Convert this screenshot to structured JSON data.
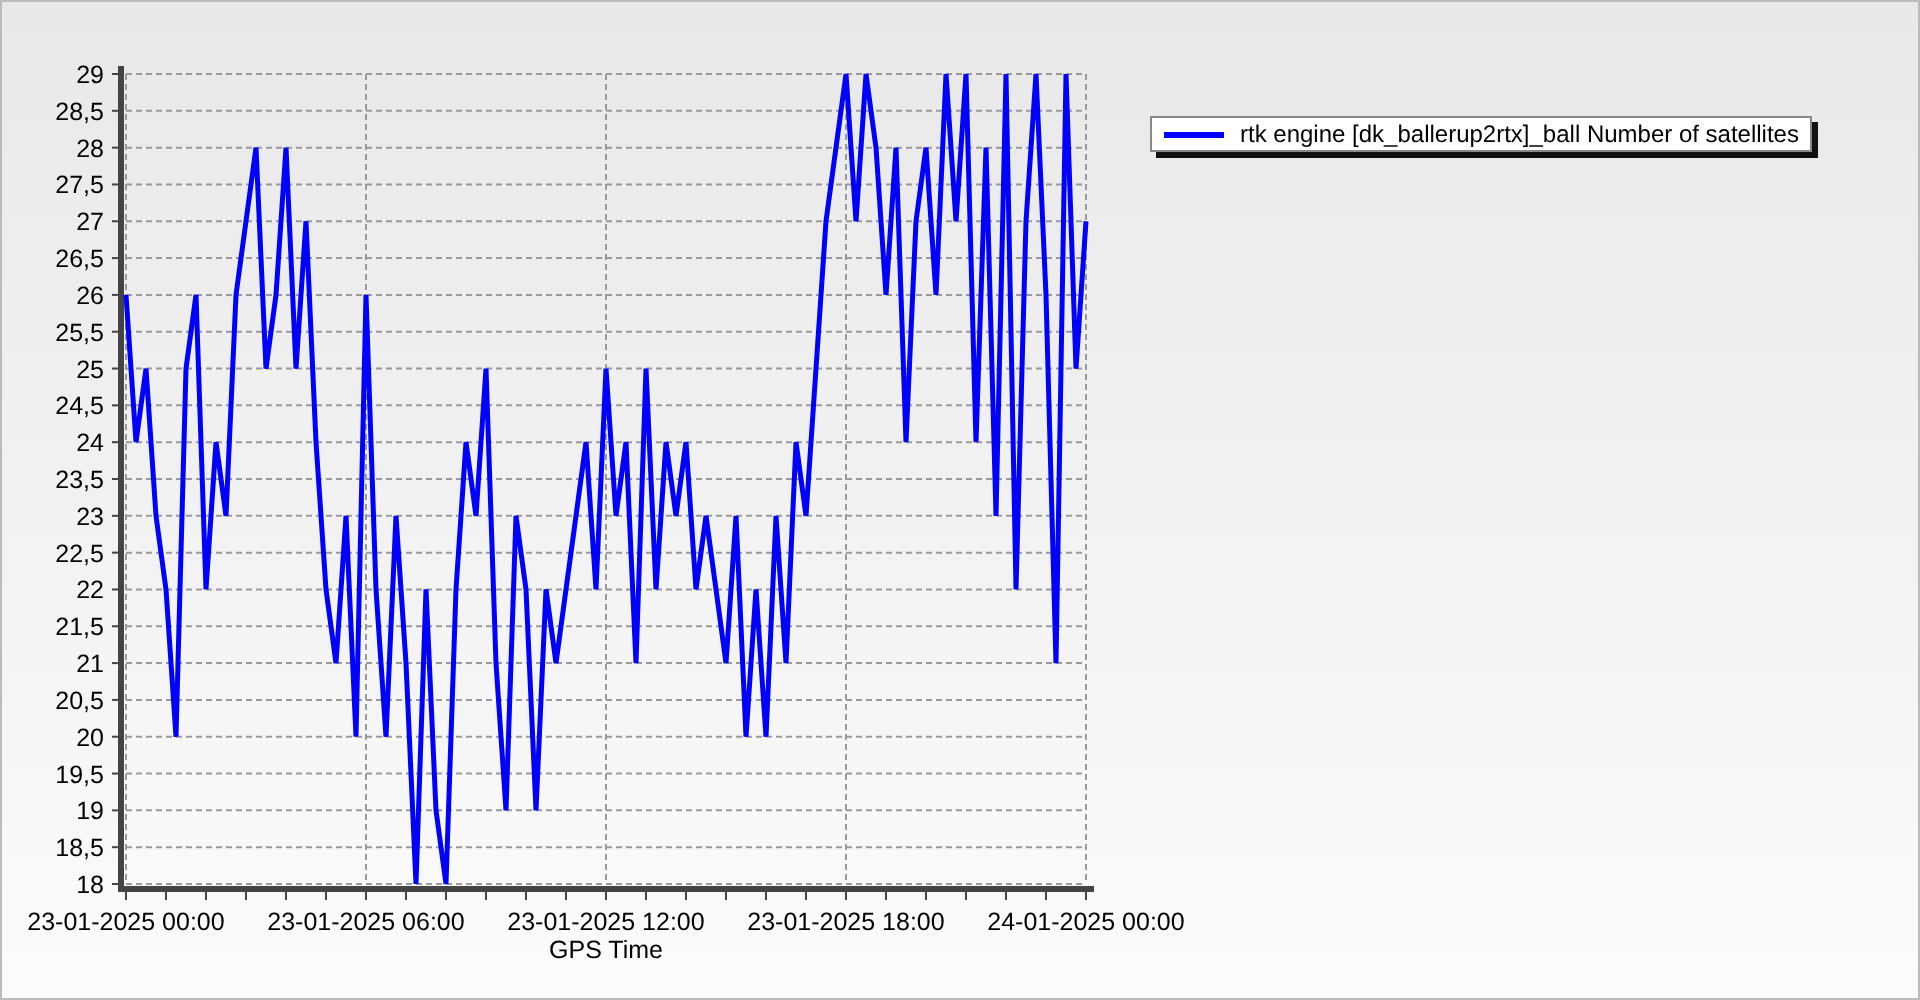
{
  "chart_data": {
    "type": "line",
    "xlabel": "GPS Time",
    "categories": [
      "23-01-2025 00:00",
      null,
      null,
      null,
      null,
      null,
      null,
      null,
      null,
      null,
      null,
      null,
      null,
      null,
      null,
      null,
      null,
      null,
      null,
      null,
      null,
      null,
      null,
      null,
      "23-01-2025 06:00",
      null,
      null,
      null,
      null,
      null,
      null,
      null,
      null,
      null,
      null,
      null,
      null,
      null,
      null,
      null,
      null,
      null,
      null,
      null,
      null,
      null,
      null,
      null,
      "23-01-2025 12:00",
      null,
      null,
      null,
      null,
      null,
      null,
      null,
      null,
      null,
      null,
      null,
      null,
      null,
      null,
      null,
      null,
      null,
      null,
      null,
      null,
      null,
      null,
      null,
      "23-01-2025 18:00",
      null,
      null,
      null,
      null,
      null,
      null,
      null,
      null,
      null,
      null,
      null,
      null,
      null,
      null,
      null,
      null,
      null,
      null,
      null,
      null,
      null,
      null,
      null,
      "24-01-2025 00:00"
    ],
    "series": [
      {
        "name": "rtk engine [dk_ballerup2rtx]_ball Number of satellites",
        "color": "#0000ff",
        "values": [
          26,
          24,
          25,
          23,
          22,
          20,
          25,
          26,
          22,
          24,
          23,
          26,
          27,
          28,
          25,
          26,
          28,
          25,
          27,
          24,
          22,
          21,
          23,
          20,
          26,
          22,
          20,
          23,
          21,
          18,
          22,
          19,
          18,
          22,
          24,
          23,
          25,
          21,
          19,
          23,
          22,
          19,
          22,
          21,
          22,
          23,
          24,
          22,
          25,
          23,
          24,
          21,
          25,
          22,
          24,
          23,
          24,
          22,
          23,
          22,
          21,
          23,
          20,
          22,
          20,
          23,
          21,
          24,
          23,
          25,
          27,
          28,
          29,
          27,
          29,
          28,
          26,
          28,
          24,
          27,
          28,
          26,
          29,
          27,
          29,
          24,
          28,
          23,
          29,
          22,
          27,
          29,
          26,
          21,
          29,
          25,
          27
        ]
      }
    ],
    "ylim": [
      18,
      29
    ],
    "grid": true,
    "yticks": [
      18,
      {
        "value": 18.5,
        "label": "18,5"
      },
      19,
      {
        "value": 19.5,
        "label": "19,5"
      },
      20,
      {
        "value": 20.5,
        "label": "20,5"
      },
      21,
      {
        "value": 21.5,
        "label": "21,5"
      },
      22,
      {
        "value": 22.5,
        "label": "22,5"
      },
      23,
      {
        "value": 23.5,
        "label": "23,5"
      },
      24,
      {
        "value": 24.5,
        "label": "24,5"
      },
      25,
      {
        "value": 25.5,
        "label": "25,5"
      },
      26,
      {
        "value": 26.5,
        "label": "26,5"
      },
      27,
      {
        "value": 27.5,
        "label": "27,5"
      },
      28,
      {
        "value": 28.5,
        "label": "28,5"
      },
      29
    ]
  }
}
